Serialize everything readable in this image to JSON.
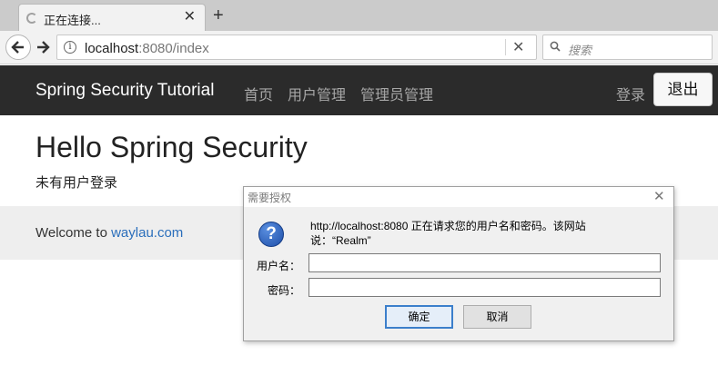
{
  "browser": {
    "tab_title": "正在连接...",
    "tab_close": "✕",
    "new_tab": "+",
    "url_host": "localhost",
    "url_rest": ":8080/index",
    "url_clear": "✕",
    "search_placeholder": "搜索"
  },
  "navbar": {
    "brand": "Spring Security Tutorial",
    "links": [
      "首页",
      "用户管理",
      "管理员管理"
    ],
    "login": "登录",
    "logout": "退出"
  },
  "page": {
    "heading": "Hello Spring Security",
    "no_user": "未有用户登录",
    "welcome_prefix": "Welcome to ",
    "welcome_link": "waylau.com"
  },
  "auth_dialog": {
    "title": "需要授权",
    "close": "✕",
    "message": "http://localhost:8080 正在请求您的用户名和密码。该网站说：“Realm”",
    "username_label": "用户名：",
    "password_label": "密码：",
    "username_value": "",
    "password_value": "",
    "ok_label": "确定",
    "cancel_label": "取消"
  },
  "colors": {
    "navbar_bg": "#2b2b2b",
    "link": "#2a6ebb",
    "jumbotron_bg": "#eeeeee"
  }
}
